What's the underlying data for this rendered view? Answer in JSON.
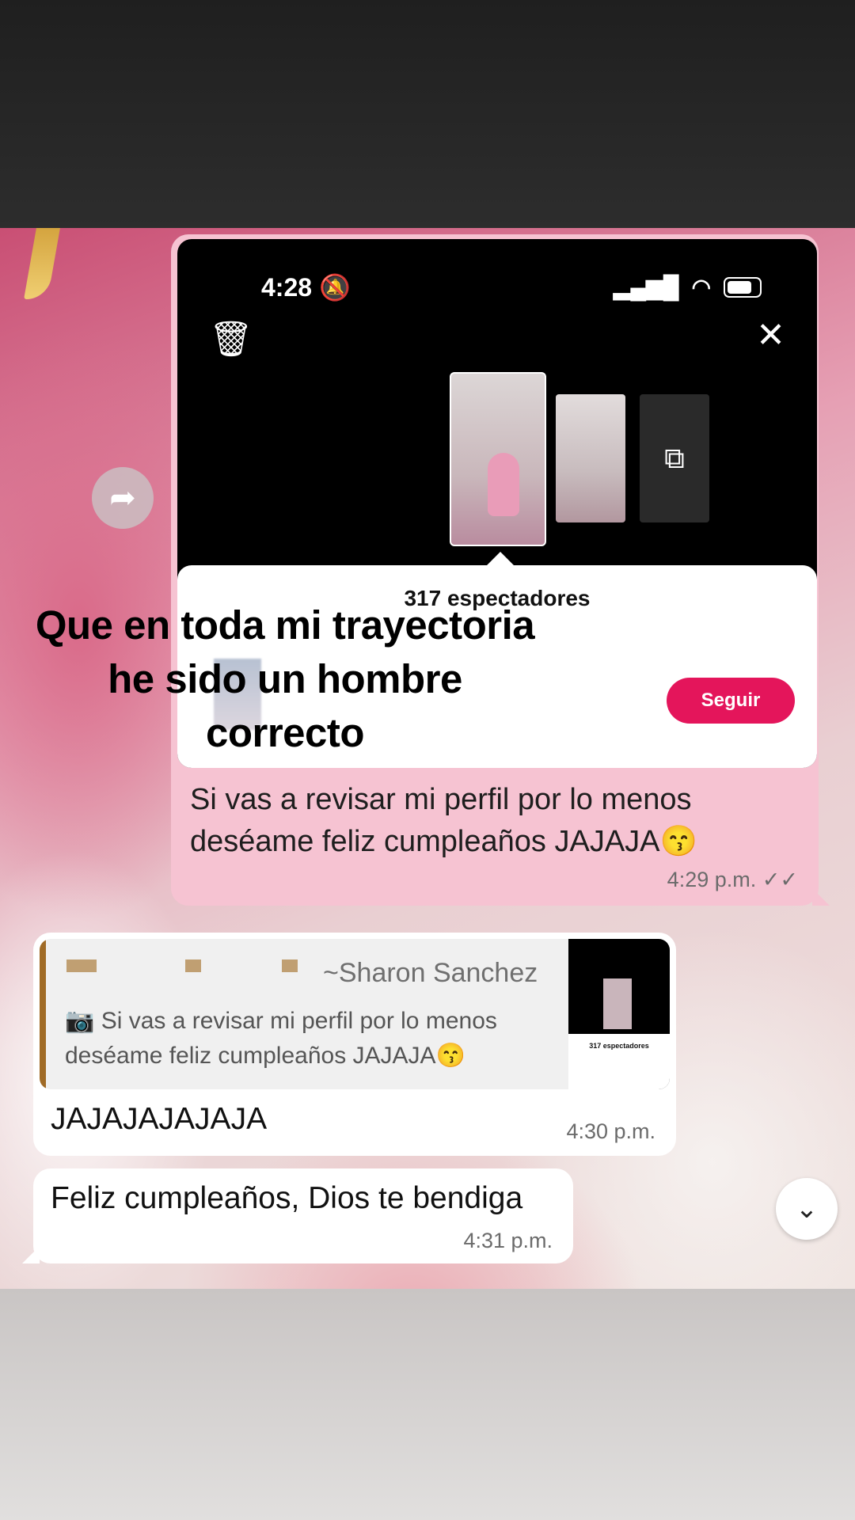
{
  "screenshot": {
    "status_time": "4:28",
    "viewers": "317 espectadores",
    "follow_label": "Seguir"
  },
  "outgoing": {
    "text": "Si vas a revisar mi perfil por lo menos deséame feliz cumpleaños JAJAJA😙",
    "time": "4:29 p.m."
  },
  "caption": "Que en toda mi trayectoria he sido un hombre correcto",
  "reply": {
    "quoted_author": "~Sharon Sanchez",
    "quoted_text": "Si vas a revisar mi perfil por lo menos deséame feliz cumpleaños JAJAJA😙",
    "quoted_thumb_caption": "317 espectadores",
    "text": "JAJAJAJAJAJA",
    "time": "4:30 p.m."
  },
  "incoming": {
    "text": "Feliz cumpleaños, Dios te bendiga",
    "time": "4:31 p.m."
  },
  "icons": {
    "forward": "forward-icon",
    "trash": "trash-icon",
    "close": "close-icon",
    "camera": "camera-icon",
    "scroll_down": "chevron-down-icon",
    "read_receipt": "double-check-icon"
  }
}
